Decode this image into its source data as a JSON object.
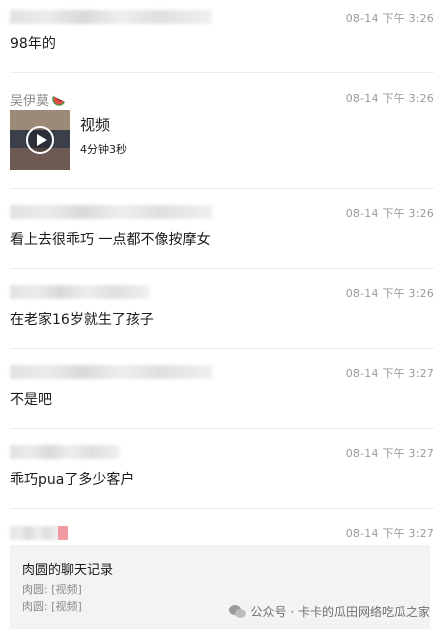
{
  "messages": [
    {
      "time": "08-14 下午 3:26",
      "text": "98年的"
    },
    {
      "sender": "吴伊莫",
      "sender_emoji_icon": "watermelon-icon",
      "time": "08-14 下午 3:26",
      "video": {
        "title": "视频",
        "duration": "4分钟3秒"
      }
    },
    {
      "time": "08-14 下午 3:26",
      "text": "看上去很乖巧 一点都不像按摩女"
    },
    {
      "time": "08-14 下午 3:26",
      "text": "在老家16岁就生了孩子"
    },
    {
      "time": "08-14 下午 3:27",
      "text": "不是吧"
    },
    {
      "time": "08-14 下午 3:27",
      "text": "乖巧pua了多少客户"
    },
    {
      "time": "08-14 下午 3:27",
      "chat_record": {
        "title": "肉圆的聊天记录",
        "lines": [
          "肉圆: [视频]",
          "肉圆: [视频]"
        ]
      }
    }
  ],
  "watermark": {
    "icon": "wechat-icon",
    "text": "公众号 · 卡卡的瓜田网络吃瓜之家"
  },
  "colors": {
    "time": "#9a9a9a",
    "divider": "#ececec",
    "card_bg": "#f3f3f3",
    "accent_pink": "#f29aa2"
  }
}
